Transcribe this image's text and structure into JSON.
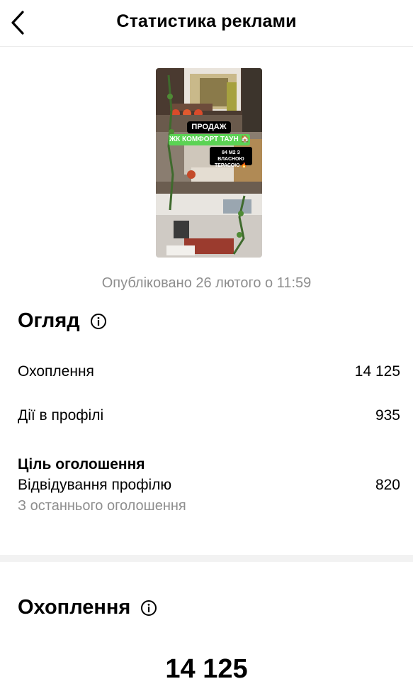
{
  "header": {
    "title": "Статистика реклами",
    "back_icon": "chevron-left-icon"
  },
  "post": {
    "overlay": {
      "badge_sale": "ПРОДАЖ",
      "badge_complex": "ЖК КОМФОРТ ТАУН 🏠",
      "badge_area": "84 м2 з власною терасою 🔥"
    },
    "published": "Опубліковано 26 лютого о 11:59"
  },
  "overview": {
    "title": "Огляд",
    "info_icon": "info-icon",
    "reach_label": "Охоплення",
    "reach_value": "14 125",
    "profile_actions_label": "Дії в профілі",
    "profile_actions_value": "935",
    "goal_label": "Ціль оголошення",
    "goal_name": "Відвідування профілю",
    "goal_value": "820",
    "goal_note": "З останнього оголошення"
  },
  "reach": {
    "title": "Охоплення",
    "info_icon": "info-icon",
    "value": "14 125"
  },
  "colors": {
    "muted_text": "#8e8e8e",
    "divider": "#f2f2f2",
    "badge_green": "#5bd354"
  }
}
